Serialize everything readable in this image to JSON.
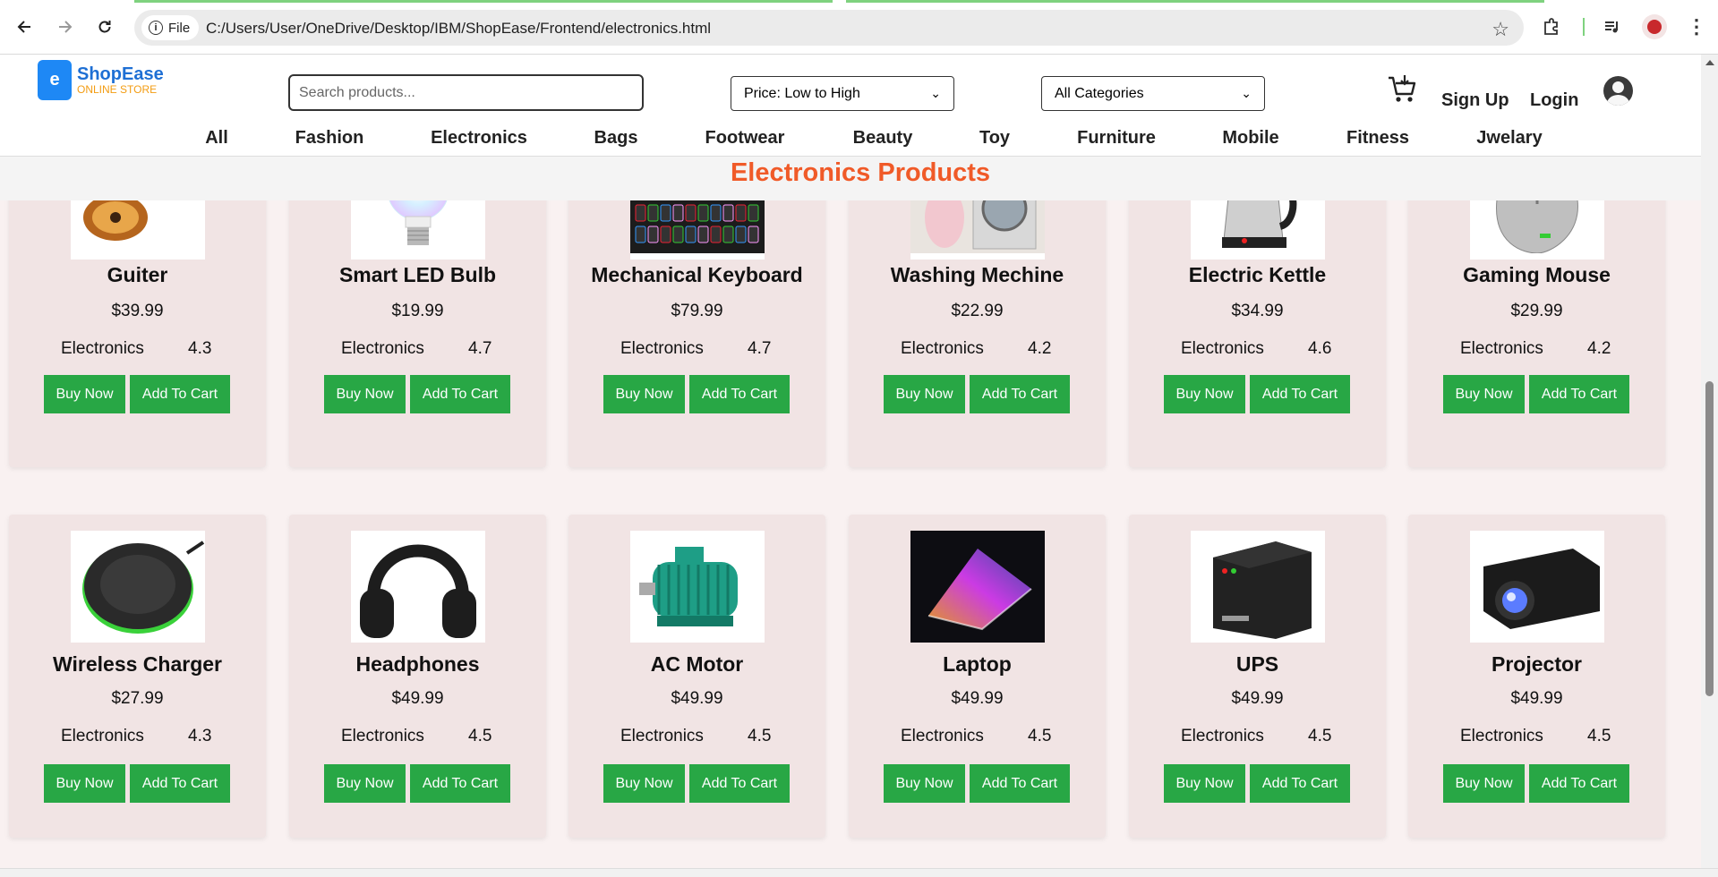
{
  "browser": {
    "url": "C:/Users/User/OneDrive/Desktop/IBM/ShopEase/Frontend/electronics.html",
    "scheme_label": "File"
  },
  "brand": {
    "logo_letter": "e",
    "name": "ShopEase",
    "tagline": "ONLINE STORE",
    "accent_color": "#1e88f5",
    "tagline_color": "#f39c12"
  },
  "search": {
    "placeholder": "Search products..."
  },
  "sort_select": {
    "selected": "Price: Low to High"
  },
  "category_select": {
    "selected": "All Categories"
  },
  "auth": {
    "signup": "Sign Up",
    "login": "Login"
  },
  "categories": [
    "All",
    "Fashion",
    "Electronics",
    "Bags",
    "Footwear",
    "Beauty",
    "Toy",
    "Furniture",
    "Mobile",
    "Fitness",
    "Jwelary"
  ],
  "section_title": "Electronics Products",
  "colors": {
    "title": "#f05a28",
    "button": "#28a745",
    "card_bg": "#f1e4e4"
  },
  "buttons": {
    "buy": "Buy Now",
    "add": "Add To Cart"
  },
  "products": [
    {
      "name": "Guiter",
      "price": "$39.99",
      "category": "Electronics",
      "rating": "4.3",
      "image": "guitar"
    },
    {
      "name": "Smart LED Bulb",
      "price": "$19.99",
      "category": "Electronics",
      "rating": "4.7",
      "image": "bulb"
    },
    {
      "name": "Mechanical Keyboard",
      "price": "$79.99",
      "category": "Electronics",
      "rating": "4.7",
      "image": "keyboard"
    },
    {
      "name": "Washing Mechine",
      "price": "$22.99",
      "category": "Electronics",
      "rating": "4.2",
      "image": "washer"
    },
    {
      "name": "Electric Kettle",
      "price": "$34.99",
      "category": "Electronics",
      "rating": "4.6",
      "image": "kettle"
    },
    {
      "name": "Gaming Mouse",
      "price": "$29.99",
      "category": "Electronics",
      "rating": "4.2",
      "image": "mouse"
    },
    {
      "name": "Wireless Charger",
      "price": "$27.99",
      "category": "Electronics",
      "rating": "4.3",
      "image": "charger"
    },
    {
      "name": "Headphones",
      "price": "$49.99",
      "category": "Electronics",
      "rating": "4.5",
      "image": "headphones"
    },
    {
      "name": "AC Motor",
      "price": "$49.99",
      "category": "Electronics",
      "rating": "4.5",
      "image": "motor"
    },
    {
      "name": "Laptop",
      "price": "$49.99",
      "category": "Electronics",
      "rating": "4.5",
      "image": "laptop"
    },
    {
      "name": "UPS",
      "price": "$49.99",
      "category": "Electronics",
      "rating": "4.5",
      "image": "ups"
    },
    {
      "name": "Projector",
      "price": "$49.99",
      "category": "Electronics",
      "rating": "4.5",
      "image": "projector"
    }
  ]
}
